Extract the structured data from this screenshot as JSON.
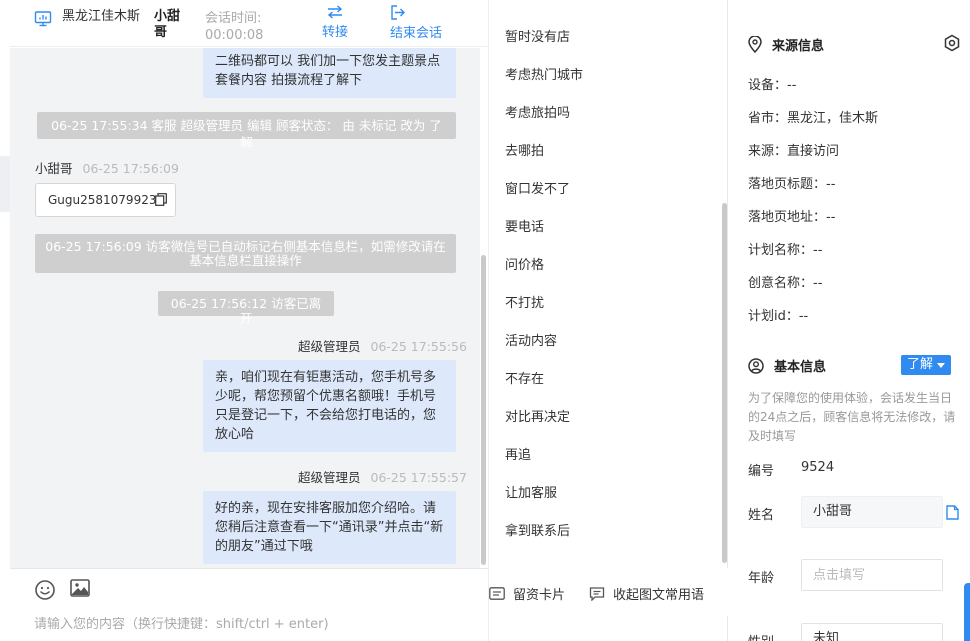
{
  "header": {
    "region": "黑龙江佳木斯",
    "name": "小甜哥",
    "session_time_label": "会话时间:",
    "session_time_value": "00:00:08",
    "transfer_label": "转接",
    "end_label": "结束会话"
  },
  "messages": {
    "bubble_top": "二维码都可以 我们加一下您发主题景点套餐内容 拍摄流程了解下",
    "system_status": "06-25 17:55:34 客服 超级管理员 编辑 顾客状态： 由 未标记 改为 了解",
    "visitor_name": "小甜哥",
    "visitor_time": "06-25 17:56:09",
    "visitor_chip": "Gugu2581079923",
    "system_wechat": "06-25 17:56:09 访客微信号已自动标记右侧基本信息栏，如需修改请在基本信息栏直接操作",
    "system_left": "06-25 17:56:12 访客已离开",
    "agent_name": "超级管理员",
    "agent_time_1": "06-25 17:55:56",
    "agent_bubble_1": "亲，咱们现在有钜惠活动，您手机号多少呢，帮您预留个优惠名额哦！手机号只是登记一下，不会给您打电话的，您放心哈",
    "agent_time_2": "06-25 17:55:57",
    "agent_bubble_2": "好的亲，现在安排客服加您介绍哈。请您稍后注意查看一下“通讯录”并点击“新的朋友”通过下哦"
  },
  "composer": {
    "placeholder": "请输入您的内容（换行快捷键：shift/ctrl + enter)"
  },
  "quick_replies": {
    "items": [
      "暂时没有店",
      "考虑热门城市",
      "考虑旅拍吗",
      "去哪拍",
      "窗口发不了",
      "要电话",
      "问价格",
      "不打扰",
      "活动内容",
      "不存在",
      "对比再决定",
      "再追",
      "让加客服",
      "拿到联系后"
    ],
    "footer_card": "留资卡片",
    "footer_collapse": "收起图文常用语"
  },
  "source_info": {
    "title": "来源信息",
    "rows": [
      "设备：--",
      "省市：黑龙江，佳木斯",
      "来源：直接访问",
      "落地页标题：--",
      "落地页地址：--",
      "计划名称：--",
      "创意名称：--",
      "计划id：--"
    ]
  },
  "basic_info": {
    "title": "基本信息",
    "status": "了解",
    "notice": "为了保障您的使用体验，会话发生当日的24点之后，顾客信息将无法修改，请及时填写",
    "number_label": "编号",
    "number_value": "9524",
    "name_label": "姓名",
    "name_value": "小甜哥",
    "age_label": "年龄",
    "age_placeholder": "点击填写",
    "gender_label": "性别",
    "gender_value": "未知"
  },
  "colors": {
    "accent": "#2f8bf0",
    "bubble": "#dde9fb",
    "system": "#cfcfcf",
    "chat_bg": "#f2f3f5"
  }
}
